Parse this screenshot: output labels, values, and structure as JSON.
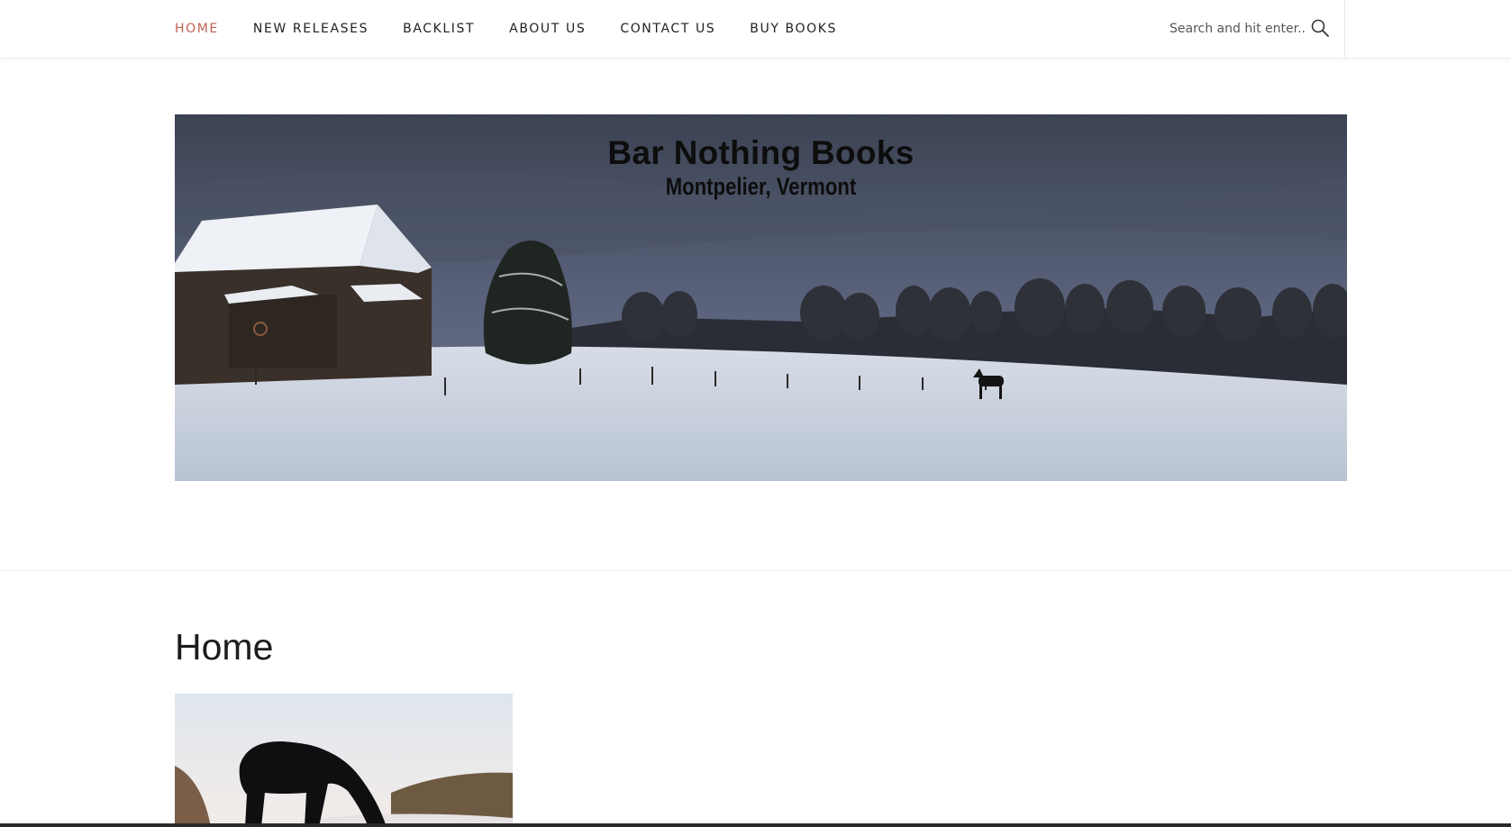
{
  "nav": {
    "items": [
      {
        "label": "HOME",
        "active": true
      },
      {
        "label": "NEW RELEASES",
        "active": false
      },
      {
        "label": "BACKLIST",
        "active": false
      },
      {
        "label": "ABOUT US",
        "active": false
      },
      {
        "label": "CONTACT US",
        "active": false
      },
      {
        "label": "BUY BOOKS",
        "active": false
      }
    ],
    "active_color": "#c0614f"
  },
  "search": {
    "placeholder": "Search and hit enter...",
    "icon": "search-icon"
  },
  "banner": {
    "title": "Bar Nothing Books",
    "subtitle": "Montpelier, Vermont"
  },
  "page": {
    "title": "Home"
  }
}
